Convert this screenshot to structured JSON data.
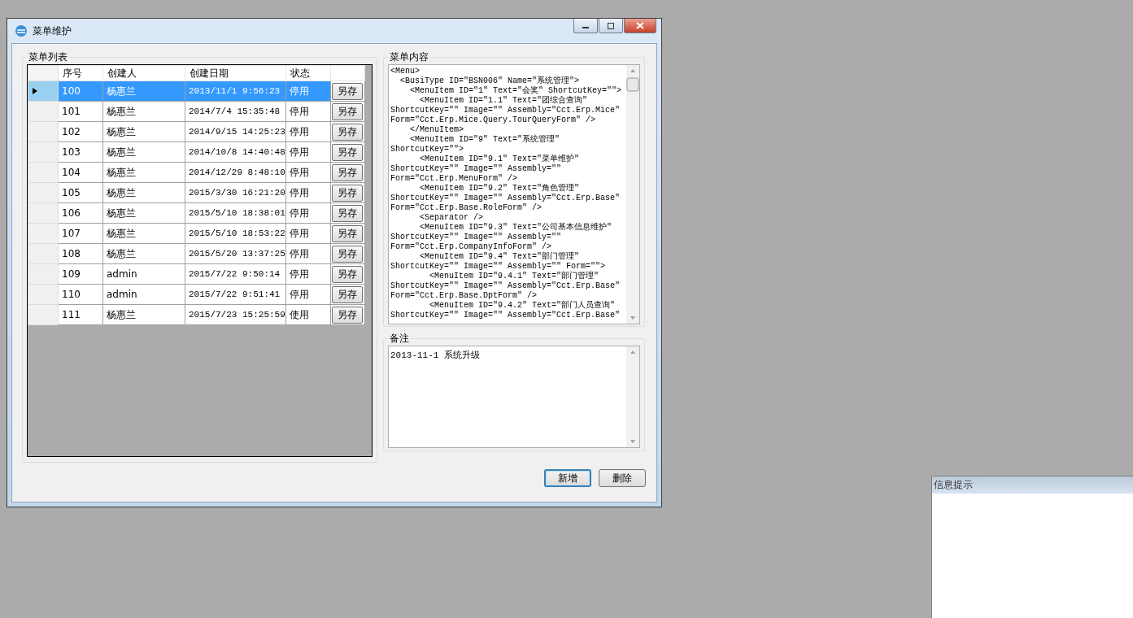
{
  "window": {
    "title": "菜单维护"
  },
  "menu_list": {
    "title": "菜单列表",
    "columns": [
      "序号",
      "创建人",
      "创建日期",
      "状态"
    ],
    "rows": [
      {
        "id": "100",
        "creator": "杨惠兰",
        "created": "2013/11/1 9:56:23",
        "status": "停用",
        "button": "另存",
        "selected": true
      },
      {
        "id": "101",
        "creator": "杨惠兰",
        "created": "2014/7/4 15:35:48",
        "status": "停用",
        "button": "另存",
        "selected": false
      },
      {
        "id": "102",
        "creator": "杨惠兰",
        "created": "2014/9/15 14:25:23",
        "status": "停用",
        "button": "另存",
        "selected": false
      },
      {
        "id": "103",
        "creator": "杨惠兰",
        "created": "2014/10/8 14:40:48",
        "status": "停用",
        "button": "另存",
        "selected": false
      },
      {
        "id": "104",
        "creator": "杨惠兰",
        "created": "2014/12/29 8:48:10",
        "status": "停用",
        "button": "另存",
        "selected": false
      },
      {
        "id": "105",
        "creator": "杨惠兰",
        "created": "2015/3/30 16:21:20",
        "status": "停用",
        "button": "另存",
        "selected": false
      },
      {
        "id": "106",
        "creator": "杨惠兰",
        "created": "2015/5/10 18:38:01",
        "status": "停用",
        "button": "另存",
        "selected": false
      },
      {
        "id": "107",
        "creator": "杨惠兰",
        "created": "2015/5/10 18:53:22",
        "status": "停用",
        "button": "另存",
        "selected": false
      },
      {
        "id": "108",
        "creator": "杨惠兰",
        "created": "2015/5/20 13:37:25",
        "status": "停用",
        "button": "另存",
        "selected": false
      },
      {
        "id": "109",
        "creator": "admin",
        "created": "2015/7/22 9:50:14",
        "status": "停用",
        "button": "另存",
        "selected": false
      },
      {
        "id": "110",
        "creator": "admin",
        "created": "2015/7/22 9:51:41",
        "status": "停用",
        "button": "另存",
        "selected": false
      },
      {
        "id": "111",
        "creator": "杨惠兰",
        "created": "2015/7/23 15:25:59",
        "status": "使用",
        "button": "另存",
        "selected": false
      }
    ]
  },
  "menu_content": {
    "title": "菜单内容",
    "lines": [
      "<Menu>",
      "  <BusiType ID=\"BSN006\" Name=\"系统管理\">",
      "    <MenuItem ID=\"1\" Text=\"会奖\" ShortcutKey=\"\">",
      "      <MenuItem ID=\"1.1\" Text=\"团综合查询\"",
      "ShortcutKey=\"\" Image=\"\" Assembly=\"Cct.Erp.Mice\"",
      "Form=\"Cct.Erp.Mice.Query.TourQueryForm\" />",
      "    </MenuItem>",
      "    <MenuItem ID=\"9\" Text=\"系统管理\"",
      "ShortcutKey=\"\">",
      "      <MenuItem ID=\"9.1\" Text=\"菜单维护\"",
      "ShortcutKey=\"\" Image=\"\" Assembly=\"\"",
      "Form=\"Cct.Erp.MenuForm\" />",
      "      <MenuItem ID=\"9.2\" Text=\"角色管理\"",
      "ShortcutKey=\"\" Image=\"\" Assembly=\"Cct.Erp.Base\"",
      "Form=\"Cct.Erp.Base.RoleForm\" />",
      "      <Separator />",
      "      <MenuItem ID=\"9.3\" Text=\"公司基本信息维护\"",
      "ShortcutKey=\"\" Image=\"\" Assembly=\"\"",
      "Form=\"Cct.Erp.CompanyInfoForm\" />",
      "      <MenuItem ID=\"9.4\" Text=\"部门管理\"",
      "ShortcutKey=\"\" Image=\"\" Assembly=\"\" Form=\"\">",
      "        <MenuItem ID=\"9.4.1\" Text=\"部门管理\"",
      "ShortcutKey=\"\" Image=\"\" Assembly=\"Cct.Erp.Base\"",
      "Form=\"Cct.Erp.Base.DptForm\" />",
      "        <MenuItem ID=\"9.4.2\" Text=\"部门人员查询\"",
      "ShortcutKey=\"\" Image=\"\" Assembly=\"Cct.Erp.Base\""
    ]
  },
  "remarks": {
    "title": "备注",
    "value": "2013-11-1 系统升级"
  },
  "buttons": [
    {
      "label": "新增",
      "focused": true
    },
    {
      "label": "删除",
      "focused": false
    }
  ],
  "info_window": {
    "title": "信息提示"
  }
}
